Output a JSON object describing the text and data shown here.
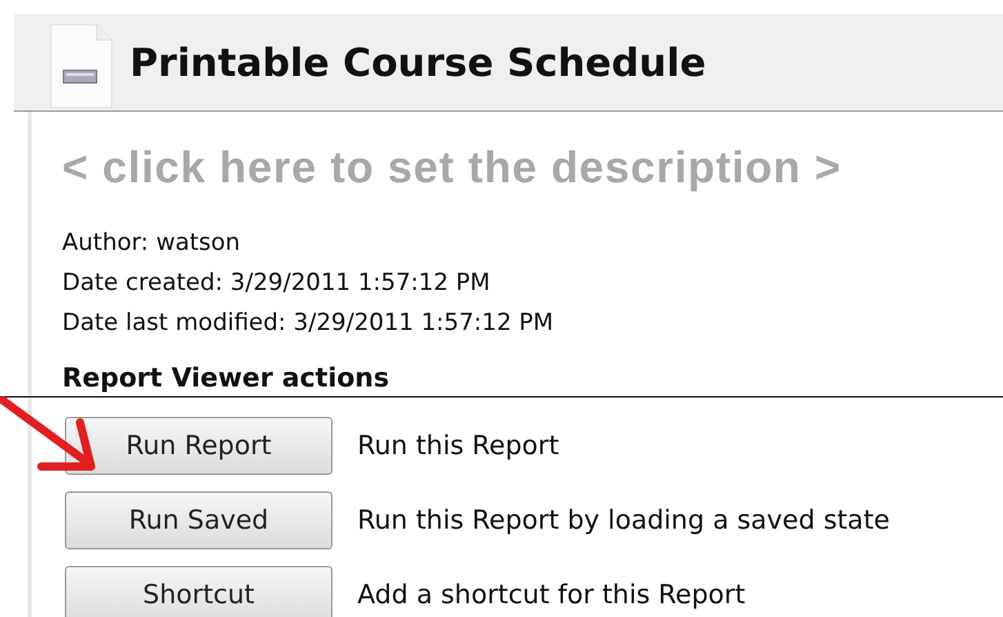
{
  "title": "Printable Course Schedule",
  "description": "< click here to set the description >",
  "meta": [
    "Author: watson",
    "Date created: 3/29/2011 1:57:12 PM",
    "Date last modified: 3/29/2011 1:57:12 PM"
  ],
  "section_title": "Report Viewer actions",
  "actions": [
    {
      "label": "Run Report",
      "description": "Run this Report"
    },
    {
      "label": "Run Saved",
      "description": "Run this Report by loading a saved state"
    },
    {
      "label": "Shortcut",
      "description": "Add a shortcut for this Report"
    }
  ]
}
